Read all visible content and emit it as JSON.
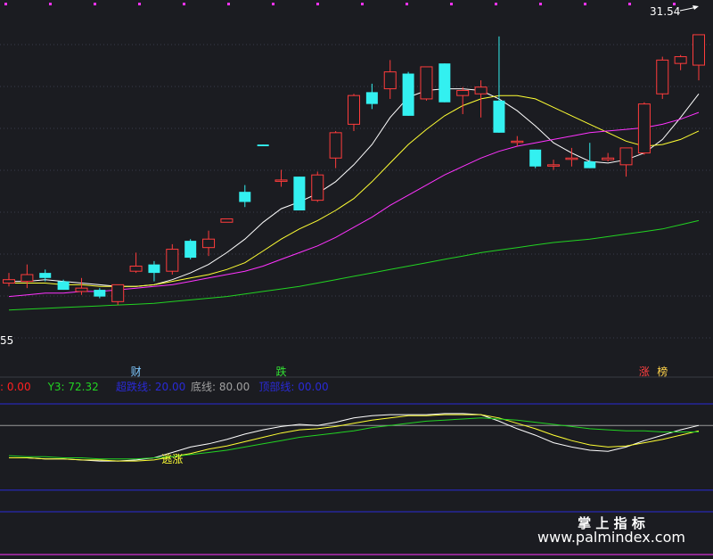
{
  "chart_data": [
    {
      "type": "candlestick",
      "panel": "price",
      "ylim": [
        13.5,
        32.5
      ],
      "high_label": "31.54",
      "low_label": "55",
      "candles": [
        {
          "o": 16.8,
          "h": 17.4,
          "l": 16.6,
          "c": 17.0
        },
        {
          "o": 16.9,
          "h": 17.9,
          "l": 16.5,
          "c": 17.3
        },
        {
          "o": 17.4,
          "h": 17.6,
          "l": 16.9,
          "c": 17.1
        },
        {
          "o": 16.9,
          "h": 17.0,
          "l": 16.4,
          "c": 16.4
        },
        {
          "o": 16.3,
          "h": 17.1,
          "l": 16.1,
          "c": 16.5
        },
        {
          "o": 16.4,
          "h": 16.5,
          "l": 15.9,
          "c": 16.0
        },
        {
          "o": 15.7,
          "h": 16.7,
          "l": 15.5,
          "c": 16.7
        },
        {
          "o": 17.5,
          "h": 18.6,
          "l": 17.4,
          "c": 17.8
        },
        {
          "o": 17.9,
          "h": 18.1,
          "l": 16.9,
          "c": 17.4
        },
        {
          "o": 17.5,
          "h": 19.1,
          "l": 17.3,
          "c": 18.8
        },
        {
          "o": 19.3,
          "h": 19.4,
          "l": 18.2,
          "c": 18.3
        },
        {
          "o": 18.9,
          "h": 19.9,
          "l": 18.4,
          "c": 19.4
        },
        {
          "o": 20.4,
          "h": 20.6,
          "l": 20.4,
          "c": 20.6
        },
        {
          "o": 22.2,
          "h": 22.6,
          "l": 21.3,
          "c": 21.6
        },
        {
          "o": 25.0,
          "h": 25.0,
          "l": 24.9,
          "c": 24.9
        },
        {
          "o": 22.9,
          "h": 23.5,
          "l": 22.5,
          "c": 22.9
        },
        {
          "o": 23.1,
          "h": 23.1,
          "l": 21.1,
          "c": 21.1
        },
        {
          "o": 21.7,
          "h": 23.4,
          "l": 21.6,
          "c": 23.2
        },
        {
          "o": 24.2,
          "h": 25.8,
          "l": 23.6,
          "c": 25.7
        },
        {
          "o": 26.2,
          "h": 28.0,
          "l": 25.8,
          "c": 27.9
        },
        {
          "o": 28.1,
          "h": 28.6,
          "l": 27.1,
          "c": 27.4
        },
        {
          "o": 28.3,
          "h": 30.0,
          "l": 27.7,
          "c": 29.3
        },
        {
          "o": 29.2,
          "h": 29.3,
          "l": 26.7,
          "c": 26.7
        },
        {
          "o": 27.7,
          "h": 29.6,
          "l": 27.6,
          "c": 29.6
        },
        {
          "o": 29.8,
          "h": 29.8,
          "l": 27.5,
          "c": 27.5
        },
        {
          "o": 27.9,
          "h": 28.4,
          "l": 26.8,
          "c": 28.2
        },
        {
          "o": 28.0,
          "h": 28.8,
          "l": 26.6,
          "c": 28.4
        },
        {
          "o": 27.6,
          "h": 31.4,
          "l": 25.7,
          "c": 25.7
        },
        {
          "o": 25.2,
          "h": 25.5,
          "l": 24.9,
          "c": 25.2
        },
        {
          "o": 24.7,
          "h": 24.7,
          "l": 23.6,
          "c": 23.7
        },
        {
          "o": 23.8,
          "h": 24.1,
          "l": 23.5,
          "c": 23.8
        },
        {
          "o": 24.2,
          "h": 24.8,
          "l": 23.7,
          "c": 24.2
        },
        {
          "o": 24.0,
          "h": 25.1,
          "l": 23.6,
          "c": 23.6
        },
        {
          "o": 24.1,
          "h": 24.5,
          "l": 24.0,
          "c": 24.2
        },
        {
          "o": 23.8,
          "h": 24.8,
          "l": 23.1,
          "c": 24.8
        },
        {
          "o": 24.5,
          "h": 27.5,
          "l": 24.4,
          "c": 27.4
        },
        {
          "o": 28.0,
          "h": 30.2,
          "l": 27.7,
          "c": 30.0
        },
        {
          "o": 29.8,
          "h": 30.3,
          "l": 29.4,
          "c": 30.2
        },
        {
          "o": 29.7,
          "h": 31.5,
          "l": 28.8,
          "c": 31.5
        }
      ],
      "ma_series": [
        {
          "color": "#ffffff",
          "values": [
            16.9,
            16.9,
            17.0,
            16.9,
            16.8,
            16.7,
            16.6,
            16.6,
            16.7,
            17.0,
            17.4,
            17.9,
            18.6,
            19.4,
            20.4,
            21.2,
            21.6,
            22.1,
            22.8,
            23.8,
            25.0,
            26.6,
            27.8,
            28.2,
            28.3,
            28.3,
            28.2,
            27.7,
            27.0,
            26.1,
            25.1,
            24.5,
            24.0,
            23.9,
            24.1,
            24.5,
            25.3,
            26.6,
            28.0
          ]
        },
        {
          "color": "#ffff33",
          "values": [
            16.8,
            16.8,
            16.8,
            16.7,
            16.7,
            16.6,
            16.6,
            16.6,
            16.7,
            16.9,
            17.1,
            17.3,
            17.6,
            18.0,
            18.7,
            19.4,
            20.0,
            20.5,
            21.1,
            21.8,
            22.8,
            23.9,
            25.0,
            25.9,
            26.7,
            27.3,
            27.7,
            27.9,
            27.9,
            27.7,
            27.2,
            26.7,
            26.2,
            25.7,
            25.2,
            24.9,
            25.0,
            25.3,
            25.8
          ]
        },
        {
          "color": "#ff33ff",
          "values": [
            16.0,
            16.1,
            16.2,
            16.2,
            16.3,
            16.3,
            16.4,
            16.5,
            16.6,
            16.7,
            16.9,
            17.1,
            17.3,
            17.5,
            17.8,
            18.2,
            18.6,
            19.0,
            19.5,
            20.1,
            20.7,
            21.4,
            22.0,
            22.6,
            23.2,
            23.7,
            24.2,
            24.6,
            24.9,
            25.1,
            25.3,
            25.5,
            25.7,
            25.8,
            25.9,
            26.0,
            26.2,
            26.5,
            26.9
          ]
        },
        {
          "color": "#22d322",
          "values": [
            15.2,
            15.25,
            15.3,
            15.35,
            15.4,
            15.45,
            15.5,
            15.55,
            15.6,
            15.7,
            15.8,
            15.9,
            16.0,
            16.15,
            16.3,
            16.45,
            16.6,
            16.8,
            17.0,
            17.2,
            17.4,
            17.6,
            17.8,
            18.0,
            18.2,
            18.4,
            18.6,
            18.75,
            18.9,
            19.05,
            19.2,
            19.3,
            19.4,
            19.55,
            19.7,
            19.85,
            20.0,
            20.25,
            20.5
          ]
        }
      ]
    },
    {
      "type": "line",
      "panel": "indicator",
      "ylim": [
        -5,
        105
      ],
      "series": [
        {
          "color": "#ffffff",
          "values": [
            50,
            50,
            49,
            49,
            48,
            47,
            47,
            48,
            50,
            55,
            60,
            63,
            67,
            72,
            76,
            79,
            81,
            80,
            83,
            87,
            89,
            90,
            90,
            90,
            91,
            91,
            90,
            84,
            77,
            71,
            64,
            60,
            57,
            56,
            60,
            66,
            71,
            76,
            80
          ]
        },
        {
          "color": "#ffff33",
          "values": [
            50,
            50,
            49,
            49,
            48,
            48,
            47,
            47,
            48,
            51,
            54,
            58,
            61,
            65,
            69,
            73,
            76,
            77,
            79,
            82,
            85,
            87,
            89,
            89,
            90,
            90,
            90,
            87,
            82,
            77,
            71,
            66,
            62,
            60,
            61,
            64,
            67,
            71,
            75
          ]
        },
        {
          "color": "#22d322",
          "values": [
            52,
            51,
            51,
            50,
            50,
            49,
            49,
            49,
            50,
            51,
            53,
            55,
            57,
            60,
            63,
            66,
            69,
            71,
            73,
            75,
            78,
            80,
            82,
            84,
            85,
            86,
            87,
            86,
            85,
            83,
            81,
            79,
            77,
            76,
            75,
            75,
            74,
            74,
            74
          ]
        }
      ],
      "ref_lines": [
        {
          "value": 100,
          "color": "#2a2ad6"
        },
        {
          "value": 80,
          "color": "#9a9a9a"
        },
        {
          "value": 20,
          "color": "#2a2ad6"
        },
        {
          "value": 0,
          "color": "#2a2ad6"
        }
      ]
    }
  ],
  "legend": [
    {
      "text": ": 0.00",
      "color": "#ff2020"
    },
    {
      "text": "Y3: 72.32",
      "color": "#22d322"
    },
    {
      "text": "超跌线: 20.00",
      "color": "#2a2ad6"
    },
    {
      "text": "底线: 80.00",
      "color": "#a0a0a0"
    },
    {
      "text": "顶部线: 00.00",
      "color": "#2a2ad6"
    }
  ],
  "signals": [
    {
      "text": "财",
      "color": "#7fc9ff",
      "candle": 7
    },
    {
      "text": "跌",
      "color": "#33e033",
      "candle": 15
    },
    {
      "text": "涨",
      "color": "#ff4040",
      "candle": 35
    },
    {
      "text": "榜",
      "color": "#ffd24a",
      "candle": 36
    }
  ],
  "indicator_signal": {
    "text": "逃涨",
    "color": "#ffff33",
    "candle": 9
  },
  "colors": {
    "up": "#ff3c3c",
    "down": "#33f0f0",
    "background": "#1b1c21"
  },
  "watermark": {
    "line1": "掌 上 指 标",
    "line2": "www.palmindex.com"
  }
}
